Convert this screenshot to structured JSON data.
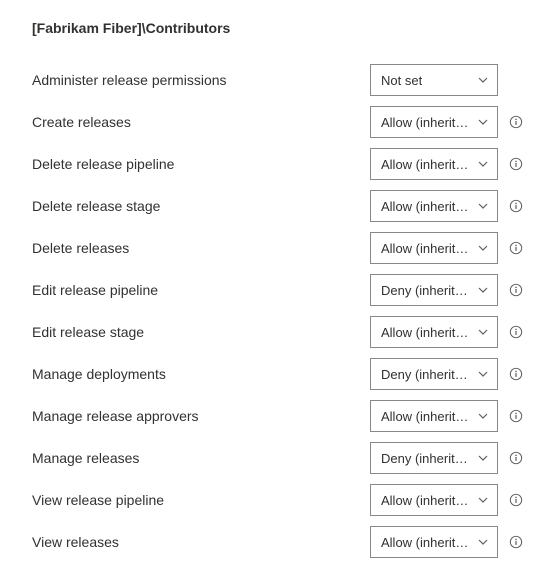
{
  "header": "[Fabrikam Fiber]\\Contributors",
  "permissions": [
    {
      "label": "Administer release permissions",
      "value": "Not set",
      "info": false
    },
    {
      "label": "Create releases",
      "value": "Allow (inherited)",
      "info": true
    },
    {
      "label": "Delete release pipeline",
      "value": "Allow (inherited)",
      "info": true
    },
    {
      "label": "Delete release stage",
      "value": "Allow (inherited)",
      "info": true
    },
    {
      "label": "Delete releases",
      "value": "Allow (inherited)",
      "info": true
    },
    {
      "label": "Edit release pipeline",
      "value": "Deny (inherited)",
      "info": true
    },
    {
      "label": "Edit release stage",
      "value": "Allow (inherited)",
      "info": true
    },
    {
      "label": "Manage deployments",
      "value": "Deny (inherited)",
      "info": true
    },
    {
      "label": "Manage release approvers",
      "value": "Allow (inherited)",
      "info": true
    },
    {
      "label": "Manage releases",
      "value": "Deny (inherited)",
      "info": true
    },
    {
      "label": "View release pipeline",
      "value": "Allow (inherited)",
      "info": true
    },
    {
      "label": "View releases",
      "value": "Allow (inherited)",
      "info": true
    }
  ]
}
